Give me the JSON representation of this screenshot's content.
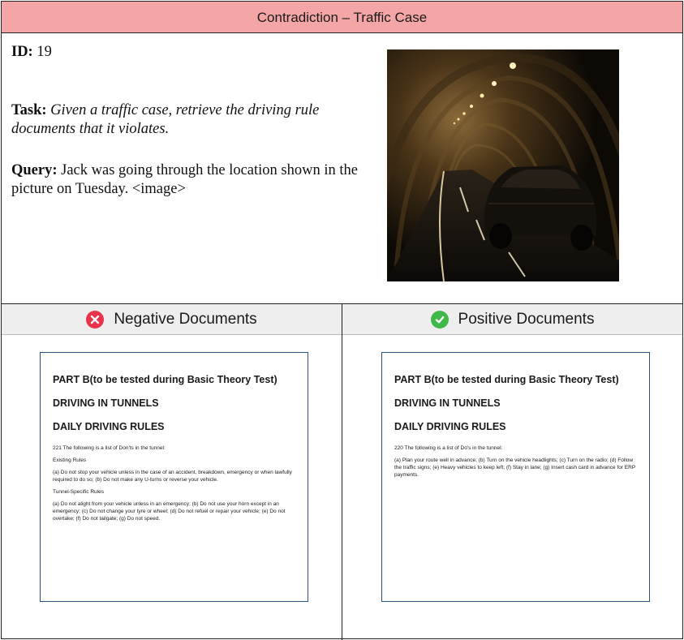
{
  "header": {
    "title": "Contradiction – Traffic Case"
  },
  "top": {
    "id_label": "ID:",
    "id_value": "19",
    "task_label": "Task:",
    "task_text": "Given a traffic case, retrieve the driving rule documents that it violates.",
    "query_label": "Query:",
    "query_text": "Jack was going through the location shown in the picture on Tuesday. <image>"
  },
  "columns": {
    "negative": {
      "heading": "Negative Documents",
      "icon": "x-circle-icon",
      "icon_color": "#e8334a",
      "doc": {
        "title_1": "PART B(to be tested during Basic Theory Test)",
        "title_2": "DRIVING IN TUNNELS",
        "title_3": "DAILY DRIVING RULES",
        "para_1": "221 The following is a list of Don'ts in the tunnel:",
        "para_2": "Existing Rules",
        "para_3": "(a) Do not stop your vehicle unless in the case of an accident, breakdown, emergency or when lawfully required to do so; (b) Do not make any U-turns or reverse your vehicle.",
        "para_4": "Tunnel-Specific Rules",
        "para_5": "(a) Do not alight from your vehicle unless in an emergency; (b) Do not use your horn except in an emergency; (c) Do not change your tyre or wheel; (d) Do not refuel or repair your vehicle; (e) Do not overtake; (f) Do not tailgate; (g) Do not speed."
      }
    },
    "positive": {
      "heading": "Positive Documents",
      "icon": "check-circle-icon",
      "icon_color": "#3fb84a",
      "doc": {
        "title_1": "PART B(to be tested during Basic Theory Test)",
        "title_2": "DRIVING IN TUNNELS",
        "title_3": "DAILY DRIVING RULES",
        "para_1": "220 The following is a list of Do's in the tunnel:",
        "para_2": "(a) Plan your route well in advance; (b) Turn on the vehicle headlights; (c) Turn on the radio; (d) Follow the traffic signs; (e) Heavy vehicles to keep left; (f) Stay in lane; (g) Insert cash card in advance for ERP payments."
      }
    }
  },
  "colors": {
    "header_bg": "#f4a6a6",
    "column_header_bg": "#eeeeee",
    "doc_border": "#2a4f7a"
  }
}
